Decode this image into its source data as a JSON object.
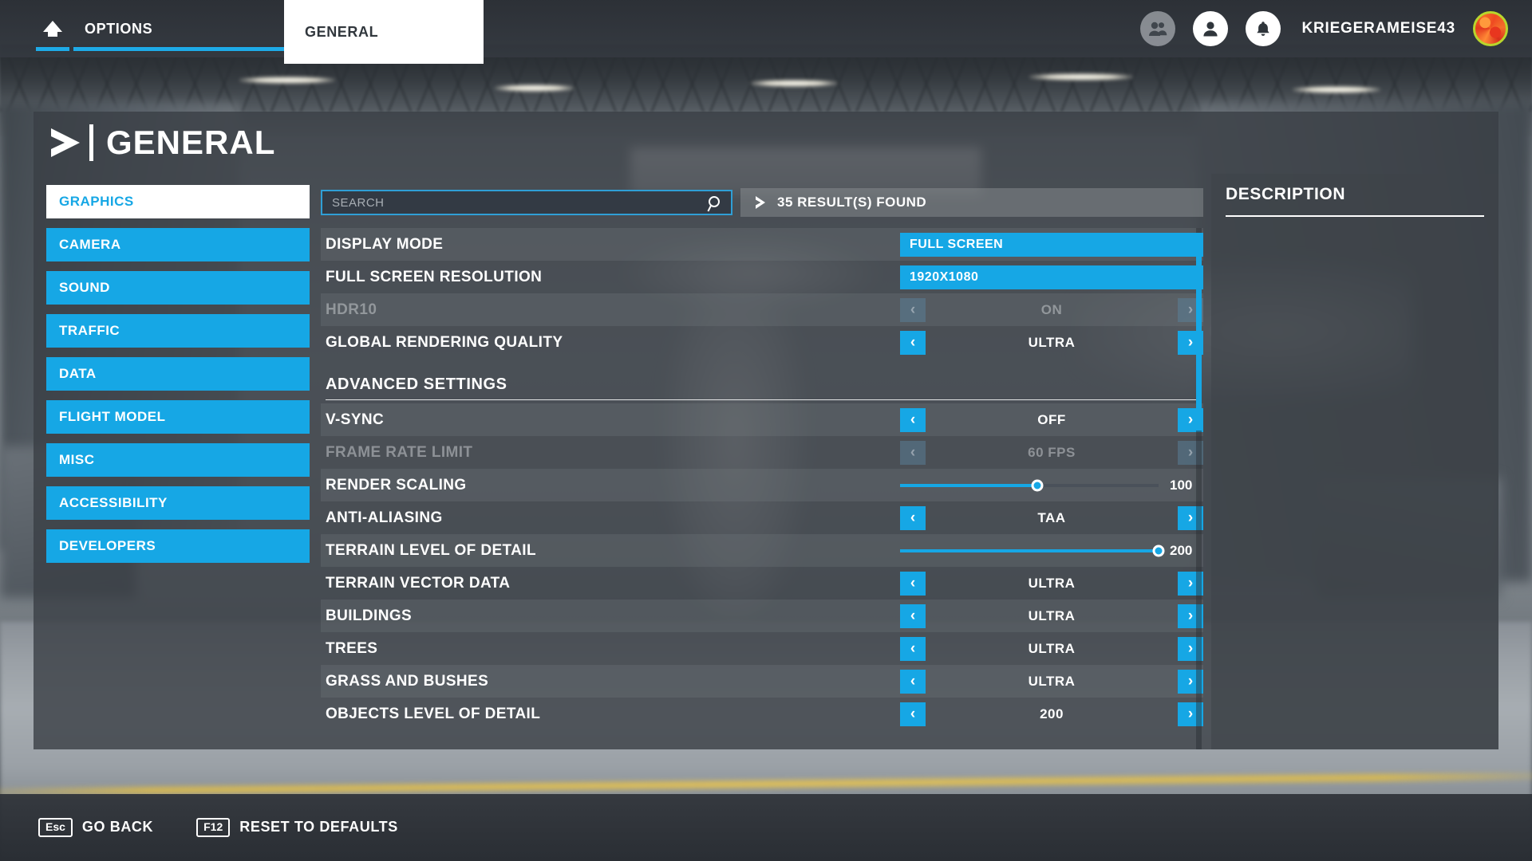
{
  "topbar": {
    "home_icon": "home-icon",
    "tab_options": "OPTIONS",
    "tab_general": "GENERAL",
    "friends_icon": "friends-icon",
    "profile_icon": "profile-icon",
    "notifications_icon": "bell-icon",
    "username": "KRIEGERAMEISE43",
    "avatar": "user-avatar",
    "accent_color": "#16a7e5"
  },
  "page": {
    "title": "GENERAL",
    "title_icon": "chevron-right-icon"
  },
  "sidebar": {
    "items": [
      {
        "label": "GRAPHICS",
        "active": true
      },
      {
        "label": "CAMERA",
        "active": false
      },
      {
        "label": "SOUND",
        "active": false
      },
      {
        "label": "TRAFFIC",
        "active": false
      },
      {
        "label": "DATA",
        "active": false
      },
      {
        "label": "FLIGHT MODEL",
        "active": false
      },
      {
        "label": "MISC",
        "active": false
      },
      {
        "label": "ACCESSIBILITY",
        "active": false
      },
      {
        "label": "DEVELOPERS",
        "active": false
      }
    ]
  },
  "search": {
    "value": "",
    "placeholder": "SEARCH",
    "icon": "search-icon",
    "results_text": "35 RESULT(S) FOUND",
    "results_count": 35,
    "results_icon": "chevron-right-icon"
  },
  "settings": {
    "rows": [
      {
        "type": "dropdown",
        "name": "DISPLAY MODE",
        "value": "FULL SCREEN",
        "disabled": false
      },
      {
        "type": "dropdown",
        "name": "FULL SCREEN RESOLUTION",
        "value": "1920X1080",
        "disabled": false
      },
      {
        "type": "stepper",
        "name": "HDR10",
        "value": "ON",
        "disabled": true
      },
      {
        "type": "stepper",
        "name": "GLOBAL RENDERING QUALITY",
        "value": "ULTRA",
        "disabled": false
      },
      {
        "type": "section",
        "name": "ADVANCED SETTINGS"
      },
      {
        "type": "stepper",
        "name": "V-SYNC",
        "value": "OFF",
        "disabled": false
      },
      {
        "type": "stepper",
        "name": "FRAME RATE LIMIT",
        "value": "60 FPS",
        "disabled": true
      },
      {
        "type": "slider",
        "name": "RENDER SCALING",
        "value": "100",
        "percent": 53,
        "disabled": false
      },
      {
        "type": "stepper",
        "name": "ANTI-ALIASING",
        "value": "TAA",
        "disabled": false
      },
      {
        "type": "slider",
        "name": "TERRAIN LEVEL OF DETAIL",
        "value": "200",
        "percent": 100,
        "disabled": false
      },
      {
        "type": "stepper",
        "name": "TERRAIN VECTOR DATA",
        "value": "ULTRA",
        "disabled": false
      },
      {
        "type": "stepper",
        "name": "BUILDINGS",
        "value": "ULTRA",
        "disabled": false
      },
      {
        "type": "stepper",
        "name": "TREES",
        "value": "ULTRA",
        "disabled": false
      },
      {
        "type": "stepper",
        "name": "GRASS AND BUSHES",
        "value": "ULTRA",
        "disabled": false
      },
      {
        "type": "stepper",
        "name": "OBJECTS LEVEL OF DETAIL",
        "value": "200",
        "disabled": false
      }
    ],
    "prev_arrow": "‹",
    "next_arrow": "›"
  },
  "description": {
    "title": "DESCRIPTION",
    "body": ""
  },
  "footer": {
    "hints": [
      {
        "key": "Esc",
        "label": "GO BACK"
      },
      {
        "key": "F12",
        "label": "RESET TO DEFAULTS"
      }
    ]
  }
}
